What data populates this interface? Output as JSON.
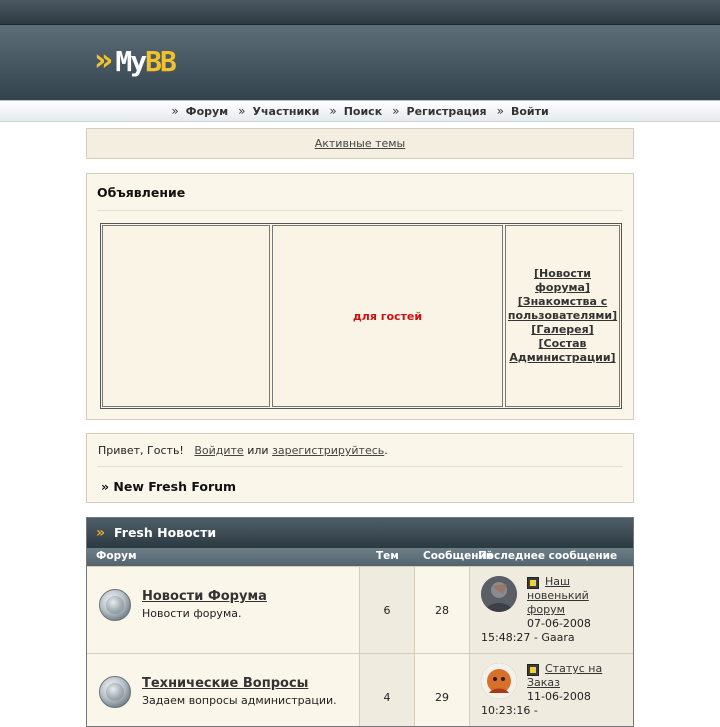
{
  "logo": {
    "text_my": "My",
    "text_bb": "BB"
  },
  "menu": {
    "items": [
      {
        "label": "Форум"
      },
      {
        "label": "Участники"
      },
      {
        "label": "Поиск"
      },
      {
        "label": "Регистрация"
      },
      {
        "label": "Войти"
      }
    ]
  },
  "active_topics": {
    "label": "Активные темы"
  },
  "announcement": {
    "title": "Объявление",
    "guest_text": "для гостей",
    "links": [
      "[Новости форума]",
      "[Знакомства с пользователями]",
      "[Галерея]",
      "[Состав Администрации]"
    ]
  },
  "welcome": {
    "greeting": "Привет, Гость!",
    "login_link": "Войдите",
    "or_text": "или",
    "register_link": "зарегистрируйтесь",
    "period": ".",
    "forum_name": "» New Fresh Forum"
  },
  "category": {
    "title": "Fresh Новости",
    "columns": {
      "forum": "Форум",
      "topics": "Тем",
      "posts": "Сообщений",
      "last_post": "Последнее сообщение"
    },
    "forums": [
      {
        "title": "Новости Форума",
        "description": "Новости форума.",
        "topics": "6",
        "posts": "28",
        "last_post_title": "Наш новенький форум",
        "last_post_date": "07-06-2008",
        "last_post_time_author": "15:48:27 - Gaara"
      },
      {
        "title": "Технические Вопросы",
        "description": "Задаем вопросы администрации.",
        "topics": "4",
        "posts": "29",
        "last_post_title": "Статус на Заказ",
        "last_post_date": "11-06-2008",
        "last_post_time_author": "10:23:16 -"
      }
    ]
  },
  "colors": {
    "header_dark": "#33424b",
    "panel_bg": "#fbf6ea",
    "accent_yellow": "#f2c12e",
    "guest_red": "#d01010"
  }
}
